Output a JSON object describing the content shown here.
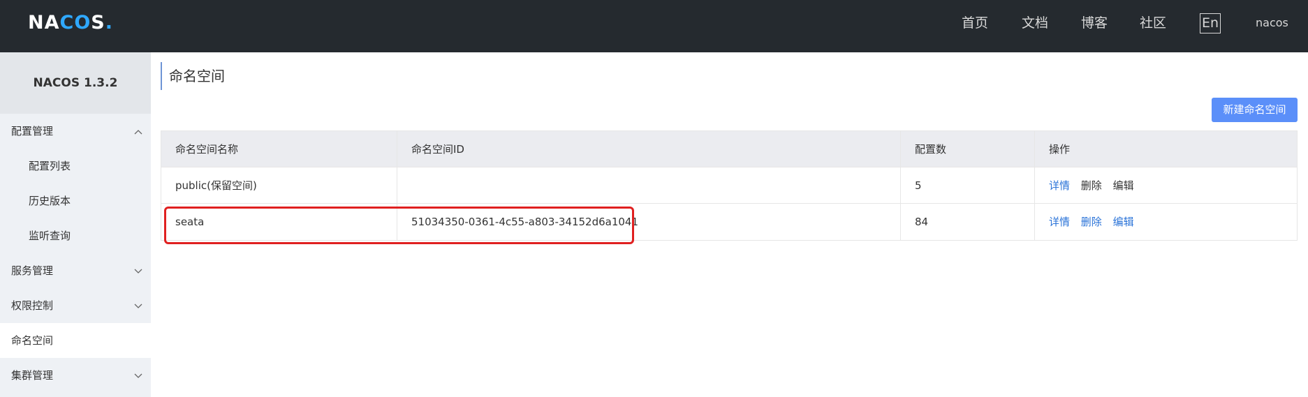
{
  "header": {
    "logo_main": "NA",
    "logo_accent": "CO",
    "logo_tail": "S",
    "logo_dot": ".",
    "nav": [
      "首页",
      "文档",
      "博客",
      "社区"
    ],
    "lang": "En",
    "user": "nacos"
  },
  "sidebar": {
    "title": "NACOS 1.3.2",
    "items": [
      {
        "label": "配置管理",
        "chevron": "^"
      },
      {
        "label": "配置列表"
      },
      {
        "label": "历史版本"
      },
      {
        "label": "监听查询"
      },
      {
        "label": "服务管理",
        "chevron": "v"
      },
      {
        "label": "权限控制",
        "chevron": "v"
      },
      {
        "label": "命名空间"
      },
      {
        "label": "集群管理",
        "chevron": "v"
      }
    ]
  },
  "main": {
    "title": "命名空间",
    "new_button": "新建命名空间",
    "table": {
      "headers": [
        "命名空间名称",
        "命名空间ID",
        "配置数",
        "操作"
      ],
      "rows": [
        {
          "name": "public(保留空间)",
          "id": "",
          "count": "5",
          "ops": [
            "详情",
            "删除",
            "编辑"
          ]
        },
        {
          "name": "seata",
          "id": "51034350-0361-4c55-a803-34152d6a1041",
          "count": "84",
          "ops": [
            "详情",
            "删除",
            "编辑"
          ]
        }
      ]
    }
  },
  "colors": {
    "header_bg": "#252a2f",
    "sidebar_bg": "#eef1f5",
    "primary": "#5b8ff9",
    "link": "#2a73d8",
    "highlight": "#e02020"
  }
}
